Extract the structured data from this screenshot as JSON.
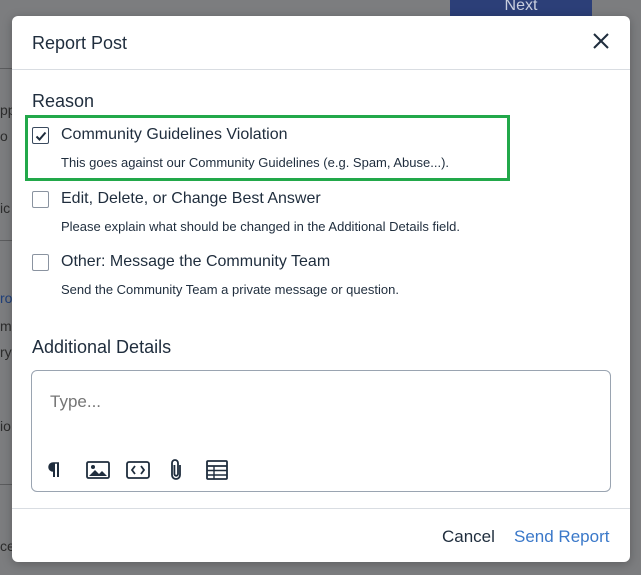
{
  "background": {
    "next_label": "Next",
    "fragments": [
      "pp",
      "o",
      "ic",
      "ro",
      "m",
      "ry",
      "io",
      "ce"
    ]
  },
  "modal": {
    "title": "Report Post",
    "reason_heading": "Reason",
    "options": [
      {
        "label": "Community Guidelines Violation",
        "description": "This goes against our Community Guidelines (e.g. Spam, Abuse...).",
        "checked": true
      },
      {
        "label": "Edit, Delete, or Change Best Answer",
        "description": "Please explain what should be changed in the Additional Details field.",
        "checked": false
      },
      {
        "label": "Other: Message the Community Team",
        "description": "Send the Community Team a private message or question.",
        "checked": false
      }
    ],
    "details_heading": "Additional Details",
    "details_placeholder": "Type...",
    "toolbar_icons": [
      "paragraph-icon",
      "image-icon",
      "code-icon",
      "attachment-icon",
      "table-icon"
    ],
    "cancel_label": "Cancel",
    "send_label": "Send Report"
  },
  "colors": {
    "highlight": "#22a84a",
    "primary_text": "#1f2d3d",
    "link": "#3a78c9",
    "overlay": "#7c7d7f"
  }
}
